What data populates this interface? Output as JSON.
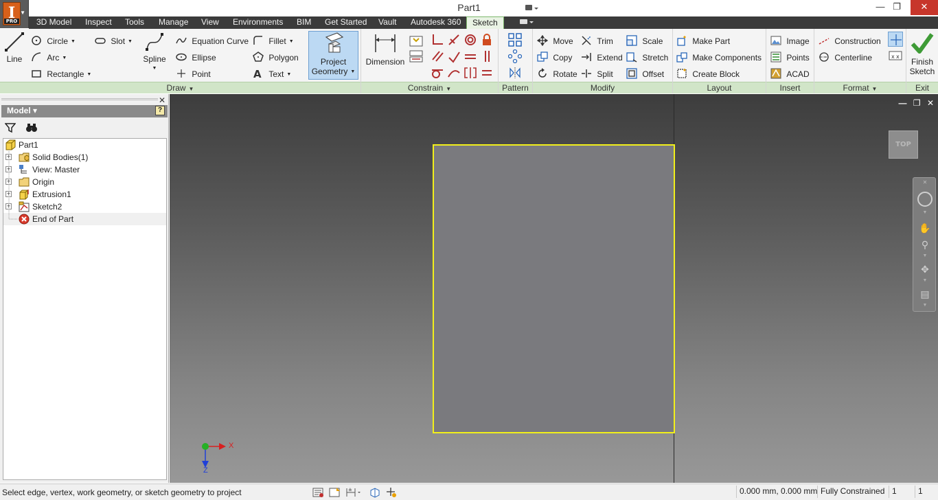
{
  "window": {
    "title": "Part1",
    "app_badge": "PRO"
  },
  "tabs": [
    {
      "label": "3D Model"
    },
    {
      "label": "Inspect"
    },
    {
      "label": "Tools"
    },
    {
      "label": "Manage"
    },
    {
      "label": "View"
    },
    {
      "label": "Environments"
    },
    {
      "label": "BIM"
    },
    {
      "label": "Get Started"
    },
    {
      "label": "Vault"
    },
    {
      "label": "Autodesk 360"
    },
    {
      "label": "Sketch",
      "active": true
    }
  ],
  "ribbon": {
    "draw": {
      "title": "Draw",
      "line": "Line",
      "circle": "Circle",
      "arc": "Arc",
      "rectangle": "Rectangle",
      "slot": "Slot",
      "spline": "Spline",
      "equation_curve": "Equation Curve",
      "ellipse": "Ellipse",
      "point": "Point",
      "fillet": "Fillet",
      "polygon": "Polygon",
      "text": "Text",
      "project_geometry_1": "Project",
      "project_geometry_2": "Geometry"
    },
    "constrain": {
      "title": "Constrain",
      "dimension": "Dimension"
    },
    "pattern": {
      "title": "Pattern"
    },
    "modify": {
      "title": "Modify",
      "move": "Move",
      "copy": "Copy",
      "rotate": "Rotate",
      "trim": "Trim",
      "extend": "Extend",
      "split": "Split",
      "scale": "Scale",
      "stretch": "Stretch",
      "offset": "Offset"
    },
    "layout": {
      "title": "Layout",
      "make_part": "Make Part",
      "make_components": "Make Components",
      "create_block": "Create Block"
    },
    "insert": {
      "title": "Insert",
      "image": "Image",
      "points": "Points",
      "acad": "ACAD"
    },
    "format": {
      "title": "Format",
      "construction": "Construction",
      "centerline": "Centerline"
    },
    "exit": {
      "title": "Exit",
      "finish_1": "Finish",
      "finish_2": "Sketch"
    }
  },
  "browser": {
    "title": "Model",
    "help": "?",
    "tree": [
      {
        "label": "Part1"
      },
      {
        "label": "Solid Bodies(1)"
      },
      {
        "label": "View: Master"
      },
      {
        "label": "Origin"
      },
      {
        "label": "Extrusion1"
      },
      {
        "label": "Sketch2"
      },
      {
        "label": "End of Part"
      }
    ]
  },
  "viewport": {
    "viewcube_label": "TOP",
    "triad": {
      "x": "X",
      "z": "Z"
    },
    "sketch_color": "#f2f01a"
  },
  "status": {
    "message": "Select edge, vertex, work geometry,  or sketch geometry to project",
    "coords": "0.000 mm, 0.000 mm",
    "constraint_state": "Fully Constrained",
    "count1": "1",
    "count2": "1"
  }
}
